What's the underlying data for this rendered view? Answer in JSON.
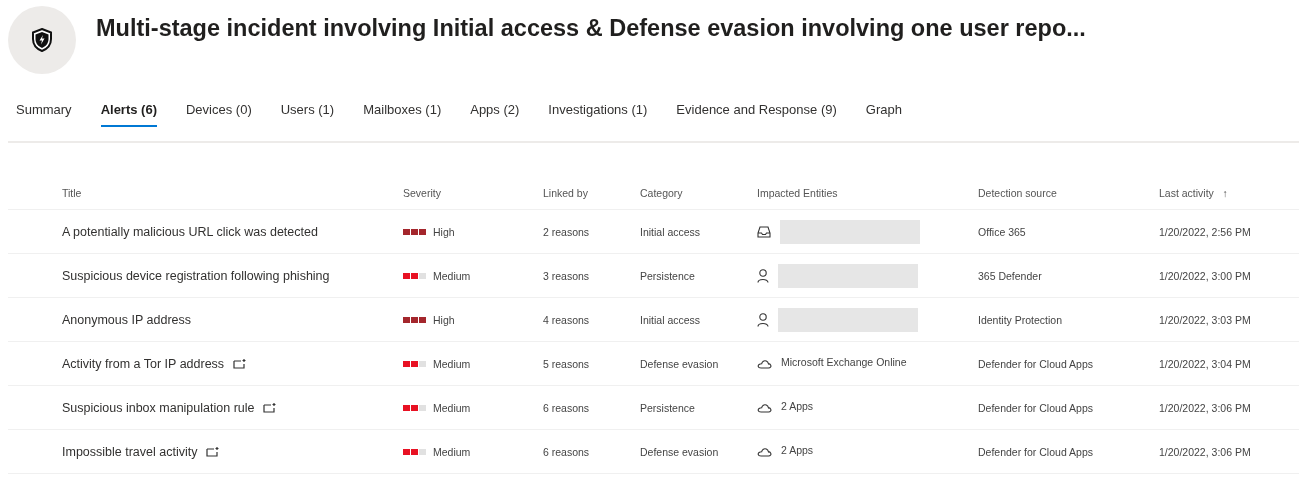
{
  "header": {
    "title": "Multi-stage incident involving Initial access & Defense evasion involving one user repo..."
  },
  "tabs": [
    {
      "label": "Summary",
      "selected": false
    },
    {
      "label": "Alerts (6)",
      "selected": true
    },
    {
      "label": "Devices (0)",
      "selected": false
    },
    {
      "label": "Users (1)",
      "selected": false
    },
    {
      "label": "Mailboxes (1)",
      "selected": false
    },
    {
      "label": "Apps (2)",
      "selected": false
    },
    {
      "label": "Investigations (1)",
      "selected": false
    },
    {
      "label": "Evidence and Response (9)",
      "selected": false
    },
    {
      "label": "Graph",
      "selected": false
    }
  ],
  "table": {
    "columns": [
      {
        "label": "Title"
      },
      {
        "label": "Severity"
      },
      {
        "label": "Linked by"
      },
      {
        "label": "Category"
      },
      {
        "label": "Impacted Entities"
      },
      {
        "label": "Detection source"
      },
      {
        "label": "Last activity",
        "sort": "↑"
      }
    ],
    "rows": [
      {
        "title": "A potentially malicious URL click was detected",
        "linked_icon": false,
        "severity": {
          "kind": "high",
          "label": "High"
        },
        "linked_by": "2 reasons",
        "category": "Initial access",
        "entity": {
          "kind": "mailbox",
          "redacted": true
        },
        "source": "Office 365",
        "last_activity": "1/20/2022, 2:56 PM"
      },
      {
        "title": "Suspicious device registration following phishing",
        "linked_icon": false,
        "severity": {
          "kind": "medium",
          "label": "Medium"
        },
        "linked_by": "3 reasons",
        "category": "Persistence",
        "entity": {
          "kind": "user",
          "redacted": true
        },
        "source": "365 Defender",
        "last_activity": "1/20/2022, 3:00 PM"
      },
      {
        "title": "Anonymous IP address",
        "linked_icon": false,
        "severity": {
          "kind": "high",
          "label": "High"
        },
        "linked_by": "4 reasons",
        "category": "Initial access",
        "entity": {
          "kind": "user",
          "redacted": true
        },
        "source": "Identity Protection",
        "last_activity": "1/20/2022, 3:03 PM"
      },
      {
        "title": "Activity from a Tor IP address",
        "linked_icon": true,
        "severity": {
          "kind": "medium",
          "label": "Medium"
        },
        "linked_by": "5 reasons",
        "category": "Defense evasion",
        "entity": {
          "kind": "app",
          "redacted": false,
          "label": "Microsoft Exchange Online"
        },
        "source": "Defender for Cloud Apps",
        "last_activity": "1/20/2022, 3:04 PM"
      },
      {
        "title": "Suspicious inbox manipulation rule",
        "linked_icon": true,
        "severity": {
          "kind": "medium",
          "label": "Medium"
        },
        "linked_by": "6 reasons",
        "category": "Persistence",
        "entity": {
          "kind": "app",
          "redacted": false,
          "label": "2 Apps"
        },
        "source": "Defender for Cloud Apps",
        "last_activity": "1/20/2022, 3:06 PM"
      },
      {
        "title": "Impossible travel activity",
        "linked_icon": true,
        "severity": {
          "kind": "medium",
          "label": "Medium"
        },
        "linked_by": "6 reasons",
        "category": "Defense evasion",
        "entity": {
          "kind": "app",
          "redacted": false,
          "label": "2 Apps"
        },
        "source": "Defender for Cloud Apps",
        "last_activity": "1/20/2022, 3:06 PM"
      }
    ]
  }
}
